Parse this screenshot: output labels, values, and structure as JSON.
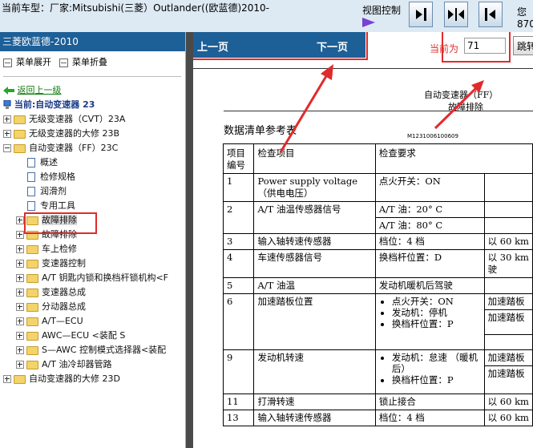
{
  "header": {
    "title": "当前车型：厂家:Mitsubishi(三菱）Outlander((欧蓝德)2010-",
    "view_control_label": "视图控制",
    "right_line1": "您",
    "right_line2": "870"
  },
  "sidebar": {
    "title": "三菱欧蓝德-2010",
    "expand_label": "菜单展开",
    "collapse_label": "菜单折叠",
    "back_label": "返回上一级",
    "current_label": "当前:自动变速器 23",
    "tree": [
      {
        "label": "无级变速器（CVT）23A",
        "type": "folder",
        "toggle": "plus"
      },
      {
        "label": "无级变速器的大修 23B",
        "type": "folder",
        "toggle": "plus"
      },
      {
        "label": "自动变速器（FF）23C",
        "type": "folder",
        "toggle": "minus"
      },
      {
        "label": "概述",
        "type": "doc"
      },
      {
        "label": "检修规格",
        "type": "doc"
      },
      {
        "label": "润滑剂",
        "type": "doc"
      },
      {
        "label": "专用工具",
        "type": "doc"
      },
      {
        "label": "故障排除",
        "type": "folder",
        "toggle": "plus",
        "selected": true
      },
      {
        "label": "故障排除",
        "type": "folder",
        "toggle": "plus"
      },
      {
        "label": "车上检修",
        "type": "folder",
        "toggle": "plus"
      },
      {
        "label": "变速器控制",
        "type": "folder",
        "toggle": "plus"
      },
      {
        "label": "A/T 钥匙内锁和换档杆锁机构<F",
        "type": "folder",
        "toggle": "plus"
      },
      {
        "label": "变速器总成",
        "type": "folder",
        "toggle": "plus"
      },
      {
        "label": "分动器总成",
        "type": "folder",
        "toggle": "plus"
      },
      {
        "label": "A/T—ECU",
        "type": "folder",
        "toggle": "plus"
      },
      {
        "label": "AWC—ECU <装配 S",
        "type": "folder",
        "toggle": "plus"
      },
      {
        "label": "S—AWC 控制模式选择器<装配",
        "type": "folder",
        "toggle": "plus"
      },
      {
        "label": "A/T 油冷却器管路",
        "type": "folder",
        "toggle": "plus"
      },
      {
        "label": "自动变速器的大修 23D",
        "type": "folder",
        "toggle": "plus"
      }
    ]
  },
  "nav": {
    "prev_label": "上一页",
    "next_label": "下一页",
    "current_label": "当前为",
    "page_value": "71",
    "jump_label": "跳转"
  },
  "document": {
    "header_line1": "自动变速器（FF）",
    "header_line2": "故障排除",
    "title": "数据清单参考表",
    "code": "M1231006100609",
    "columns": [
      "项目编号",
      "检查项目",
      "检查要求",
      ""
    ],
    "rows": {
      "r1": {
        "no": "1",
        "item": "Power supply voltage （供电电压）",
        "cond": "点火开关：ON"
      },
      "r2": {
        "no": "2",
        "item": "A/T 油温传感器信号",
        "cond_a": "A/T 油：20° C",
        "cond_b": "A/T 油：80° C"
      },
      "r3": {
        "no": "3",
        "item": "输入轴转速传感器",
        "cond": "档位：4 档",
        "val": "以 60 km"
      },
      "r4": {
        "no": "4",
        "item": "车速传感器信号",
        "cond": "换档杆位置：D",
        "val_a": "以 30 km",
        "val_b": "驶"
      },
      "r5": {
        "no": "5",
        "item": "A/T 油温",
        "cond": "发动机暖机后驾驶"
      },
      "r6": {
        "no": "6",
        "item": "加速踏板位置",
        "b1": "点火开关：ON",
        "b2": "发动机：停机",
        "b3": "换档杆位置：P",
        "v1": "加速踏板",
        "v2": "加速踏板"
      },
      "r9": {
        "no": "9",
        "item": "发动机转速",
        "b1": "发动机：怠速 （暖机后）",
        "b2": "换档杆位置：P",
        "v1": "加速踏板",
        "v2": "加速踏板"
      },
      "r11": {
        "no": "11",
        "item": "打滑转速",
        "cond": "锁止接合",
        "val": "以 60 km"
      },
      "r13": {
        "no": "13",
        "item": "输入轴转速传感器",
        "cond": "档位：4 档",
        "val": "以 60 km"
      }
    }
  },
  "colors": {
    "accent_blue": "#1d5f97",
    "annotation_red": "#e02b2b",
    "link_green": "#0f7a0f",
    "arrow_purple": "#7a3fd6"
  }
}
